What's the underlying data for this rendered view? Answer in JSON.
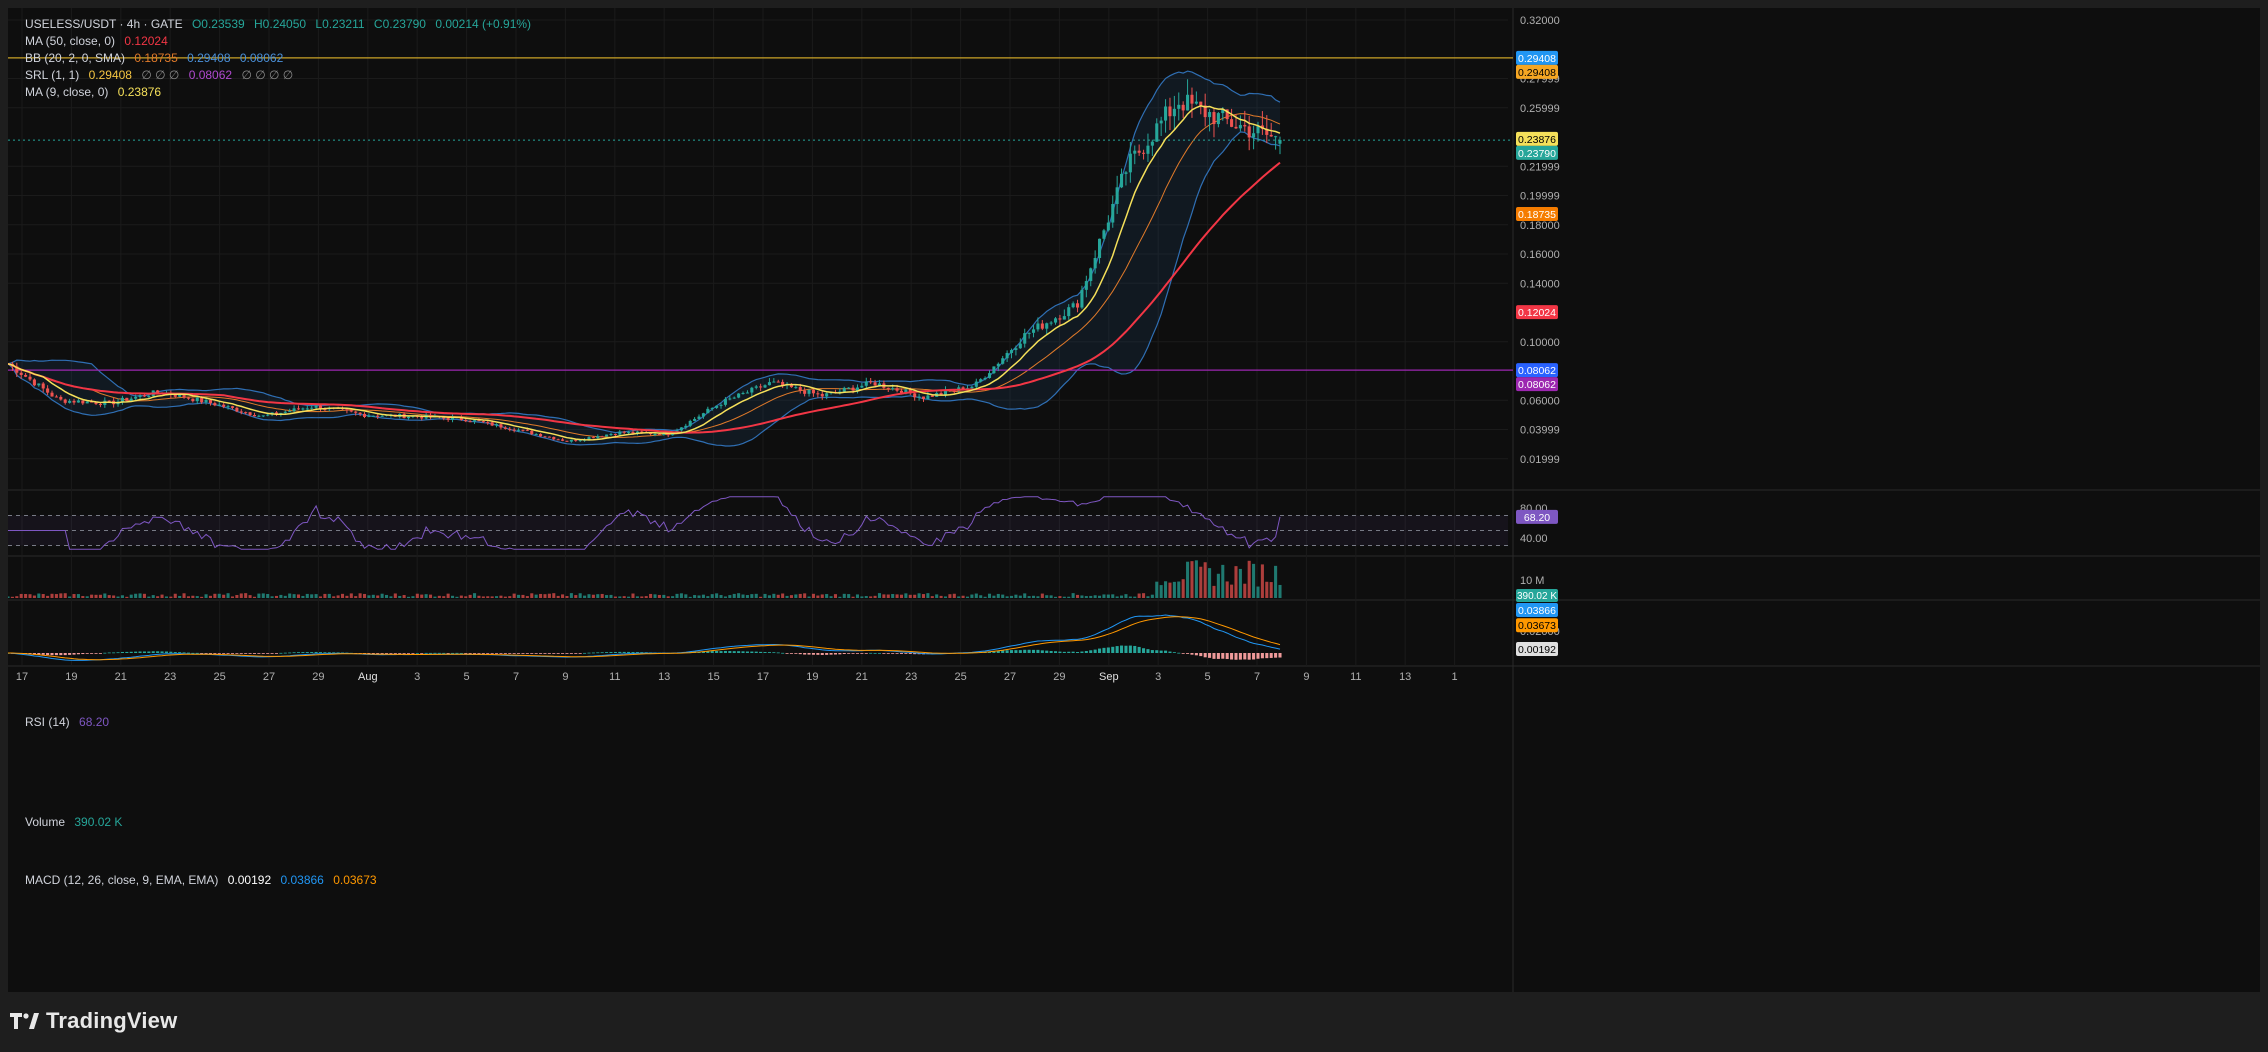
{
  "legend": {
    "symbol": "USELESS/USDT · 4h · GATE",
    "ohlc": {
      "o": "O0.23539",
      "h": "H0.24050",
      "l": "L0.23211",
      "c": "C0.23790",
      "chg": "0.00214 (+0.91%)"
    },
    "ma50": {
      "label": "MA (50, close, 0)",
      "value": "0.12024"
    },
    "bb": {
      "label": "BB (20, 2, 0, SMA)",
      "basis": "0.18735",
      "upper": "0.29408",
      "lower": "0.08062"
    },
    "srl": {
      "label": "SRL (1, 1)",
      "v1": "0.29408",
      "rest": "∅ ∅ ∅",
      "v2": "0.08062",
      "rest2": "∅ ∅ ∅ ∅"
    },
    "ma9": {
      "label": "MA (9, close, 0)",
      "value": "0.23876"
    },
    "rsi": {
      "label": "RSI (14)",
      "value": "68.20"
    },
    "volume": {
      "label": "Volume",
      "value": "390.02 K"
    },
    "macd": {
      "label": "MACD (12, 26, close, 9, EMA, EMA)",
      "hist": "0.00192",
      "macd": "0.03866",
      "signal": "0.03673"
    }
  },
  "colors": {
    "up": "#26a69a",
    "down": "#ef5350",
    "ma9": "#f5e05a",
    "ma50": "#f23645",
    "bb_band": "#2f6fb4",
    "bb_basis": "#e07a2a",
    "resistance": "#c9a227",
    "support": "#9c27b0",
    "rsi": "#7e57c2",
    "macd": "#2196f3",
    "signal": "#ff9800"
  },
  "footer": {
    "brand": "TradingView"
  },
  "chart_data": [
    {
      "type": "candlestick",
      "title": "USELESS/USDT · 4h · GATE",
      "price_axis": {
        "ticks": [
          "0.32000",
          "0.27999",
          "0.25999",
          "0.21999",
          "0.19999",
          "0.18000",
          "0.16000",
          "0.14000",
          "0.10000",
          "0.06000",
          "0.03999",
          "0.01999"
        ],
        "ylim": [
          0.0,
          0.32
        ]
      },
      "time_axis": [
        "17",
        "19",
        "21",
        "23",
        "25",
        "27",
        "29",
        "Aug",
        "3",
        "5",
        "7",
        "9",
        "11",
        "13",
        "15",
        "17",
        "19",
        "21",
        "23",
        "25",
        "27",
        "29",
        "Sep",
        "3",
        "5",
        "7",
        "9",
        "11",
        "13",
        "1"
      ],
      "key_points_close": [
        {
          "date": "Jul 16",
          "close": 0.085
        },
        {
          "date": "Jul 18",
          "close": 0.06
        },
        {
          "date": "Jul 20",
          "close": 0.058
        },
        {
          "date": "Jul 22",
          "close": 0.066
        },
        {
          "date": "Jul 24",
          "close": 0.058
        },
        {
          "date": "Jul 26",
          "close": 0.049
        },
        {
          "date": "Jul 28",
          "close": 0.056
        },
        {
          "date": "Jul 30",
          "close": 0.05
        },
        {
          "date": "Aug 2",
          "close": 0.049
        },
        {
          "date": "Aug 5",
          "close": 0.047
        },
        {
          "date": "Aug 9",
          "close": 0.04
        },
        {
          "date": "Aug 13",
          "close": 0.032
        },
        {
          "date": "Aug 16",
          "close": 0.038
        },
        {
          "date": "Aug 19",
          "close": 0.037
        },
        {
          "date": "Aug 21",
          "close": 0.058
        },
        {
          "date": "Aug 23",
          "close": 0.072
        },
        {
          "date": "Aug 25",
          "close": 0.063
        },
        {
          "date": "Aug 28",
          "close": 0.072
        },
        {
          "date": "Aug 30",
          "close": 0.062
        },
        {
          "date": "Sep 1",
          "close": 0.07
        },
        {
          "date": "Sep 2",
          "close": 0.105
        },
        {
          "date": "Sep 3",
          "close": 0.125
        },
        {
          "date": "Sep 4",
          "close": 0.22
        },
        {
          "date": "Sep 4.5",
          "close": 0.265
        },
        {
          "date": "Sep 5",
          "close": 0.25
        },
        {
          "date": "Sep 5.5",
          "close": 0.2379
        }
      ],
      "last": {
        "open": 0.23539,
        "high": 0.2405,
        "low": 0.23211,
        "close": 0.2379
      },
      "price_labels": [
        "0.29408",
        "0.29408",
        "0.23876",
        "0.23790",
        "0.18735",
        "0.12024",
        "0.08062",
        "0.08062"
      ]
    },
    {
      "type": "line",
      "title": "RSI (14)",
      "ylim": [
        20,
        100
      ],
      "bands": [
        70,
        50,
        30
      ],
      "ticks": [
        "80.00",
        "40.00"
      ],
      "last": 68.2
    },
    {
      "type": "bar",
      "title": "Volume",
      "ticks": [
        "10 M"
      ],
      "last": "390.02 K"
    },
    {
      "type": "line",
      "title": "MACD (12, 26, close, 9, EMA, EMA)",
      "ticks": [
        "0.02000"
      ],
      "last": {
        "macd": 0.03866,
        "signal": 0.03673,
        "hist": 0.00192
      }
    }
  ]
}
